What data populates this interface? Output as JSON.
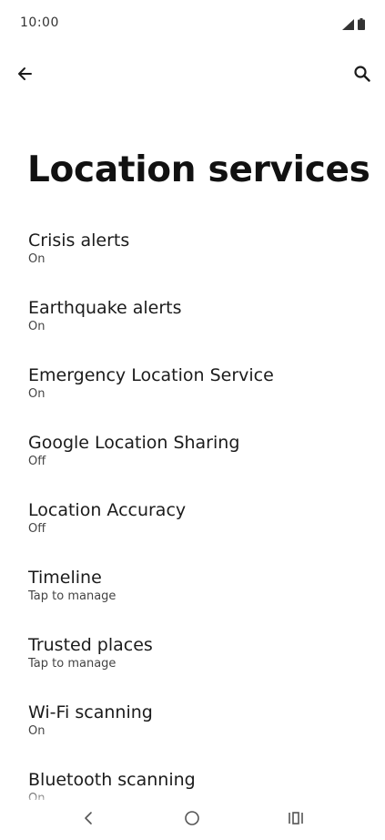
{
  "status_bar": {
    "time": "10:00",
    "icons": [
      "cell-signal-icon",
      "battery-icon"
    ]
  },
  "toolbar": {
    "back_icon": "arrow-back-icon",
    "search_icon": "search-icon"
  },
  "page": {
    "title": "Location services"
  },
  "settings": [
    {
      "title": "Crisis alerts",
      "summary": "On"
    },
    {
      "title": "Earthquake alerts",
      "summary": "On"
    },
    {
      "title": "Emergency Location Service",
      "summary": "On"
    },
    {
      "title": "Google Location Sharing",
      "summary": "Off"
    },
    {
      "title": "Location Accuracy",
      "summary": "Off"
    },
    {
      "title": "Timeline",
      "summary": "Tap to manage"
    },
    {
      "title": "Trusted places",
      "summary": "Tap to manage"
    },
    {
      "title": "Wi-Fi scanning",
      "summary": "On"
    },
    {
      "title": "Bluetooth scanning",
      "summary": "On"
    }
  ],
  "nav_bar": {
    "icons": [
      "nav-back-icon",
      "nav-home-icon",
      "nav-recents-icon"
    ]
  },
  "colors": {
    "background": "#ffffff",
    "text_primary": "#1b1b1b",
    "text_secondary": "#444444"
  }
}
